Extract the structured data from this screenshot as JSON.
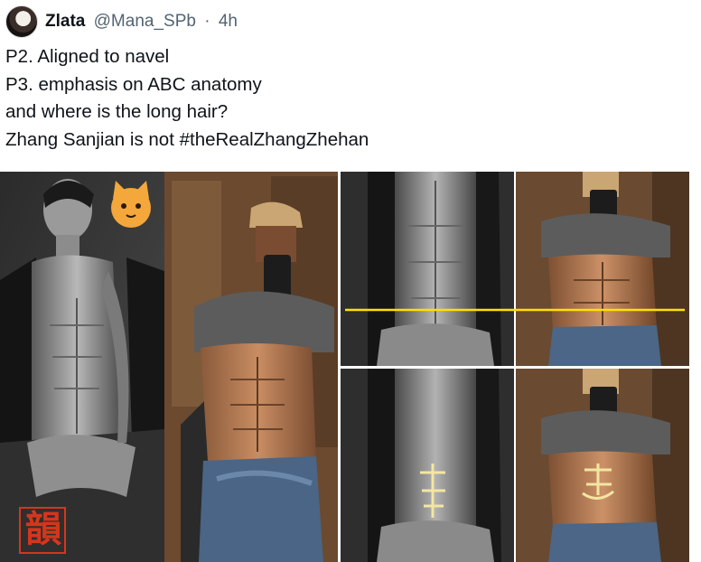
{
  "tweet": {
    "author_name": "Zlata",
    "handle": "@Mana_SPb",
    "separator": "·",
    "time": "4h",
    "lines": [
      "P2. Aligned to navel",
      "P3. emphasis on ABC anatomy",
      "and where is the long hair?",
      "Zhang Sanjian is not #theRealZhangZhehan"
    ]
  },
  "media": {
    "seal_text": "韻",
    "navel_line_color": "#ffe100",
    "marker_color": "#f3e6a0"
  }
}
